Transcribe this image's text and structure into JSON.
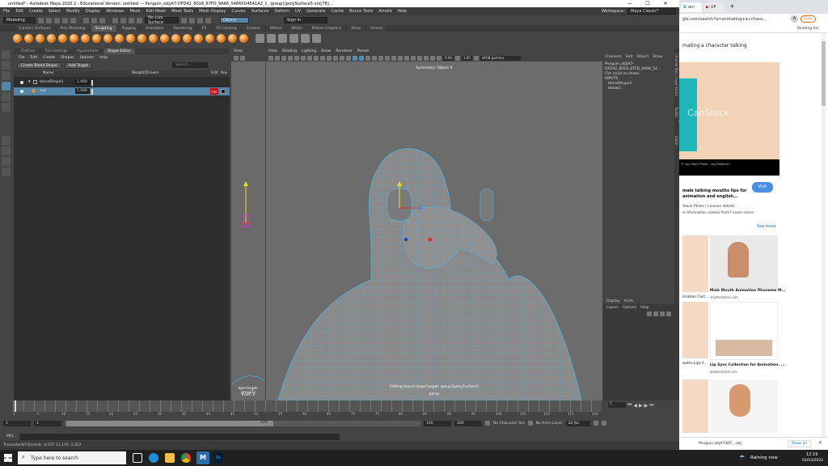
{
  "maya": {
    "title": "untitled* - Autodesk Maya 2020.2 - Educational Version: untitled   ---   Penguin_obj|A7-DFD42_8018_67FD_9A66_54665D45A1A2_1_:group1|polySurface5.vtx[78]...",
    "menus": [
      "File",
      "Edit",
      "Create",
      "Select",
      "Modify",
      "Display",
      "Windows",
      "Mesh",
      "Edit Mesh",
      "Mesh Tools",
      "Mesh Display",
      "Curves",
      "Surfaces",
      "Deform",
      "UV",
      "Generate",
      "Cache",
      "Bonus Tools",
      "Arnold",
      "Help"
    ],
    "workspace_label": "Workspace:",
    "workspace_value": "Maya Classic*",
    "mode_value": "Modeling",
    "live_surface": "No Live Surface",
    "object_label": "Object",
    "sign_in": "Sign In",
    "shelf_tabs": [
      "Curves / Surfaces",
      "Poly Modeling",
      "Sculpting",
      "Rigging",
      "Animation",
      "Rendering",
      "FX",
      "FX Caching",
      "Custom",
      "Bifrost",
      "MASH",
      "Motion Graphics",
      "XGen",
      "Arnold"
    ],
    "shelf_active": "Sculpting"
  },
  "shape_editor": {
    "tabs": [
      "Outliner",
      "Tool Settings",
      "Hypershade",
      "Shape Editor"
    ],
    "active_tab": "Shape Editor",
    "menu": [
      "File",
      "Edit",
      "Create",
      "Shapes",
      "Options",
      "Help"
    ],
    "create_blend_shape": "Create Blend Shape",
    "add_target": "Add Target",
    "search_placeholder": "Search...",
    "col_name": "Name",
    "col_weight": "Weight/Drivers",
    "col_edit": "Edit",
    "col_key": "Key",
    "rows": [
      {
        "name": "blendShape1",
        "weight": "1.000",
        "edit": "",
        "selected": false
      },
      {
        "name": "ooo",
        "weight": "1.000",
        "edit": "Edit",
        "selected": true
      }
    ]
  },
  "viewport": {
    "side_menu": [
      "View"
    ],
    "menu": [
      "View",
      "Shading",
      "Lighting",
      "Show",
      "Renderer",
      "Panels"
    ],
    "symmetry": "Symmetry: Object X",
    "field_a": "0.00",
    "field_b": "1.00",
    "colorspace": "sRGB gamma",
    "side_overlay_line1": "ape target: group1|",
    "side_overlay_line2": "front -Z",
    "footer_line1": "Editing blend shape target: group1|polySurface5",
    "footer_line2": "persp"
  },
  "channel_box": {
    "tabs": [
      "Channels",
      "Edit",
      "Object",
      "Show"
    ],
    "lines": [
      "Penguin_obj|A7-DFD42_8018_67FD_9A66_54...",
      "CVs (click to show)",
      "INPUTS",
      "blendShape1",
      "tweak1"
    ],
    "display_tabs": [
      "Display",
      "Anim"
    ],
    "display_menu": [
      "Layers",
      "Options",
      "Help"
    ],
    "side_tabs": [
      "Channel Box / Layer Editor",
      "Modeling Toolkit",
      "Attribute Editor"
    ]
  },
  "timeline": {
    "ticks": [
      "1",
      "5",
      "10",
      "15",
      "20",
      "25",
      "30",
      "35",
      "40",
      "45",
      "50",
      "55",
      "60",
      "65",
      "70",
      "75",
      "80",
      "85",
      "90",
      "95",
      "100",
      "105",
      "110",
      "115",
      "120"
    ],
    "current_frame": "1",
    "range_start": "1",
    "range_start2": "1",
    "range_end_inner": "120",
    "range_end": "120",
    "range_end2": "200",
    "character_set": "No Character Set",
    "anim_layer": "No Anim Layer",
    "fps": "24 fps"
  },
  "mel": {
    "label": "MEL",
    "help": "Translate/X/Y/Z/cmds     -0.075     11.170     -1.322"
  },
  "browser": {
    "tabs": [
      "ani",
      "UP"
    ],
    "url": "gle.com/search?q=animating+a+chara...",
    "profile_letter": "A",
    "error_label": "Error",
    "reading_list": "Reading list",
    "page_title": "mating a character talking",
    "stock_watermark": "CanStock",
    "img1_caption": "© Can Stock Photo - csp72880447",
    "visit": "Visit",
    "result_title": "male talking mouths lips for animation and english...",
    "result_source": "Stock Photo | License details",
    "result_note": "e information comes from? Learn more",
    "see_more": "See more",
    "r1_left": "imation Cart...",
    "r1_right_title": "Male Mouth Animation Phoneme M...",
    "r1_right_src": "shutterstock.com",
    "r2_left": "ouths Lips f...",
    "r2_right_title": "Lip Sync Collection for Animation. ...",
    "r2_right_src": "dreamstime.com",
    "download_file": "Penguin.objA73DF....obj",
    "show_all": "Show all"
  },
  "taskbar": {
    "search_placeholder": "Type here to search",
    "weather": "Raining now",
    "time": "12:19",
    "date": "02/03/2022"
  },
  "colors": {
    "maya_bg": "#444444",
    "selection_blue": "#5285a6",
    "edit_red": "#d40000",
    "wire_blue": "#49b8e6",
    "visit_blue": "#4a90e2"
  }
}
